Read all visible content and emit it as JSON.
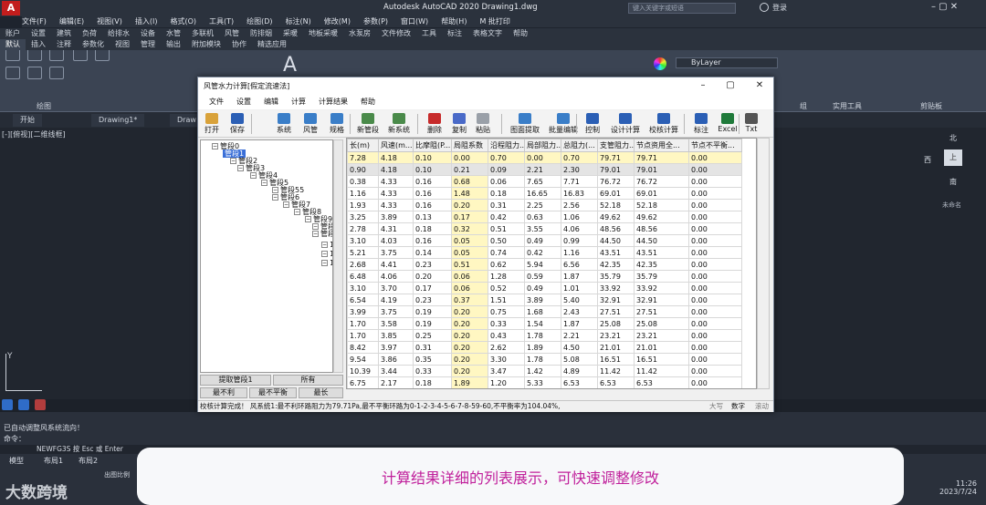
{
  "autocad": {
    "title": "Autodesk AutoCAD 2020    Drawing1.dwg",
    "search_placeholder": "键入关键字或短语",
    "login": "登录",
    "menu": [
      "文件(F)",
      "编辑(E)",
      "视图(V)",
      "插入(I)",
      "格式(O)",
      "工具(T)",
      "绘图(D)",
      "标注(N)",
      "修改(M)",
      "参数(P)",
      "窗口(W)",
      "帮助(H)",
      "M 批打印"
    ],
    "ribbon_tabs": [
      "默认",
      "插入",
      "注释",
      "参数化",
      "视图",
      "管理",
      "输出",
      "附加模块",
      "协作",
      "精选应用"
    ],
    "ribbon_top_row": [
      "账户",
      "设置",
      "建筑",
      "负荷",
      "给排水",
      "设备",
      "水管",
      "多联机",
      "风管",
      "防排烟",
      "采暖",
      "地板采暖",
      "水泵房",
      "文件修改",
      "工具",
      "标注",
      "表格文字",
      "帮助"
    ],
    "ribbon_panels": [
      "绘图",
      "组",
      "实用工具",
      "剪贴板"
    ],
    "layer_name": "ByLayer",
    "doc_tabs": [
      "开始",
      "Drawing1*",
      "Draw"
    ],
    "viewport_label": "[-][俯视][二维线框]",
    "viewcube": {
      "north": "北",
      "west": "西",
      "top": "上",
      "south": "南",
      "wcs": "未命名"
    },
    "cmd_lines": [
      "已自动调整风系统流向！",
      "命令："
    ],
    "cmd_input": "NEWFG3S 按 Esc 或 Enter",
    "layout_tabs": [
      "模型",
      "布局1",
      "布局2"
    ],
    "status_scale": "出图比例",
    "clock_time": "11:26",
    "clock_date": "2023/7/24"
  },
  "dialog": {
    "title": "风管水力计算[假定流速法]",
    "menu": [
      "文件",
      "设置",
      "编辑",
      "计算",
      "计算结果",
      "帮助"
    ],
    "toolbar": [
      "打开",
      "保存",
      "系统",
      "风管",
      "规格",
      "新管段",
      "新系统",
      "删除",
      "复制",
      "粘贴",
      "图面提取",
      "批量编辑",
      "控制",
      "设计计算",
      "校核计算",
      "标注",
      "Excel",
      "Txt"
    ],
    "tree": [
      "管段0",
      "管段1",
      "管段2",
      "管段3",
      "管段4",
      "管段5",
      "管段55",
      "管段6",
      "管段7",
      "管段8",
      "管段9",
      "管段9",
      "管段9",
      "1",
      "1",
      "1"
    ],
    "tree_buttons": [
      "提取管段1",
      "所有",
      "最不利",
      "最不平衡",
      "最长"
    ],
    "columns": [
      "长(m)",
      "风速(m...",
      "比摩阻(P...",
      "局阻系数",
      "沿程阻力...",
      "局部阻力...",
      "总阻力(...",
      "支管阻力...",
      "节点资用全...",
      "节点不平衡..."
    ],
    "rows": [
      [
        "7.28",
        "4.18",
        "0.10",
        "0.00",
        "0.70",
        "0.00",
        "0.70",
        "79.71",
        "79.71",
        "0.00"
      ],
      [
        "0.90",
        "4.18",
        "0.10",
        "0.21",
        "0.09",
        "2.21",
        "2.30",
        "79.01",
        "79.01",
        "0.00"
      ],
      [
        "0.38",
        "4.33",
        "0.16",
        "0.68",
        "0.06",
        "7.65",
        "7.71",
        "76.72",
        "76.72",
        "0.00"
      ],
      [
        "1.16",
        "4.33",
        "0.16",
        "1.48",
        "0.18",
        "16.65",
        "16.83",
        "69.01",
        "69.01",
        "0.00"
      ],
      [
        "1.93",
        "4.33",
        "0.16",
        "0.20",
        "0.31",
        "2.25",
        "2.56",
        "52.18",
        "52.18",
        "0.00"
      ],
      [
        "3.25",
        "3.89",
        "0.13",
        "0.17",
        "0.42",
        "0.63",
        "1.06",
        "49.62",
        "49.62",
        "0.00"
      ],
      [
        "2.78",
        "4.31",
        "0.18",
        "0.32",
        "0.51",
        "3.55",
        "4.06",
        "48.56",
        "48.56",
        "0.00"
      ],
      [
        "3.10",
        "4.03",
        "0.16",
        "0.05",
        "0.50",
        "0.49",
        "0.99",
        "44.50",
        "44.50",
        "0.00"
      ],
      [
        "5.21",
        "3.75",
        "0.14",
        "0.05",
        "0.74",
        "0.42",
        "1.16",
        "43.51",
        "43.51",
        "0.00"
      ],
      [
        "2.68",
        "4.41",
        "0.23",
        "0.51",
        "0.62",
        "5.94",
        "6.56",
        "42.35",
        "42.35",
        "0.00"
      ],
      [
        "6.48",
        "4.06",
        "0.20",
        "0.06",
        "1.28",
        "0.59",
        "1.87",
        "35.79",
        "35.79",
        "0.00"
      ],
      [
        "3.10",
        "3.70",
        "0.17",
        "0.06",
        "0.52",
        "0.49",
        "1.01",
        "33.92",
        "33.92",
        "0.00"
      ],
      [
        "6.54",
        "4.19",
        "0.23",
        "0.37",
        "1.51",
        "3.89",
        "5.40",
        "32.91",
        "32.91",
        "0.00"
      ],
      [
        "3.99",
        "3.75",
        "0.19",
        "0.20",
        "0.75",
        "1.68",
        "2.43",
        "27.51",
        "27.51",
        "0.00"
      ],
      [
        "1.70",
        "3.58",
        "0.19",
        "0.20",
        "0.33",
        "1.54",
        "1.87",
        "25.08",
        "25.08",
        "0.00"
      ],
      [
        "1.70",
        "3.85",
        "0.25",
        "0.20",
        "0.43",
        "1.78",
        "2.21",
        "23.21",
        "23.21",
        "0.00"
      ],
      [
        "8.42",
        "3.97",
        "0.31",
        "0.20",
        "2.62",
        "1.89",
        "4.50",
        "21.01",
        "21.01",
        "0.00"
      ],
      [
        "9.54",
        "3.86",
        "0.35",
        "0.20",
        "3.30",
        "1.78",
        "5.08",
        "16.51",
        "16.51",
        "0.00"
      ],
      [
        "10.39",
        "3.44",
        "0.33",
        "0.20",
        "3.47",
        "1.42",
        "4.89",
        "11.42",
        "11.42",
        "0.00"
      ],
      [
        "6.75",
        "2.17",
        "0.18",
        "1.89",
        "1.20",
        "5.33",
        "6.53",
        "6.53",
        "6.53",
        "0.00"
      ]
    ],
    "status": "校核计算完成！  风系统1:最不利环路阻力为79.71Pa,最不平衡环路为0-1-2-3-4-5-6-7-8-59-60,不平衡率为104.04%,",
    "status_right": [
      "大写",
      "数字",
      "滚动"
    ]
  },
  "caption": "计算结果详细的列表展示，可快速调整修改",
  "watermark": "大数跨境",
  "colors": {
    "caption": "#c01f9b",
    "autocad_red": "#c21d1d",
    "selection": "#3a6fd8",
    "highlight_col": "#fff7c2"
  }
}
